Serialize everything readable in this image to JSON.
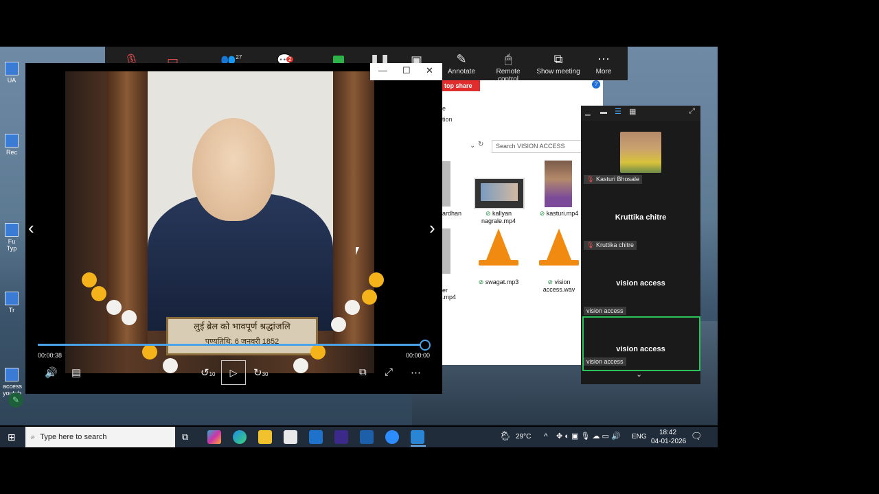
{
  "zoom_toolbar": {
    "participants_count": "27",
    "chat_badge": "2",
    "items": [
      {
        "label": "Annotate",
        "icon": "pencil-icon"
      },
      {
        "label": "Remote control",
        "icon": "mouse-icon"
      },
      {
        "label": "Show meeting",
        "icon": "meeting-windows-icon"
      },
      {
        "label": "More",
        "icon": "more-icon"
      }
    ],
    "stop_share": "top share"
  },
  "desktop_icons": [
    {
      "label": "UA"
    },
    {
      "label": "Rec"
    },
    {
      "label": "Fu Typ"
    },
    {
      "label": "Tr"
    },
    {
      "label": "access youtub"
    }
  ],
  "explorer": {
    "partial_text_1": "e",
    "partial_text_2": "tion",
    "search_placeholder": "Search VISION ACCESS",
    "files": [
      {
        "name": "ardhan",
        "checked": false
      },
      {
        "name": "kallyan nagrale.mp4",
        "checked": true
      },
      {
        "name": "kasturi.mp4",
        "checked": true
      },
      {
        "name": "er .mp4",
        "checked": false
      },
      {
        "name": "swagat.mp3",
        "checked": true
      },
      {
        "name": "vision access.wav",
        "checked": true
      }
    ]
  },
  "player": {
    "plaque_line1": "लुई ब्रेल को भावपूर्ण श्रद्धांजलि",
    "plaque_line2": "पुण्यतिथि: 6 जनवरी 1852",
    "time_elapsed": "00:00:38",
    "time_remaining": "00:00:00",
    "progress": 1.0,
    "skip_back": "10",
    "skip_forward": "30"
  },
  "gallery": {
    "participants": [
      {
        "name": "Kasturi Bhosale",
        "display": "",
        "muted": true
      },
      {
        "name": "Kruttika chitre",
        "display": "Kruttika chitre",
        "muted": true
      },
      {
        "name": "vision access",
        "display": "vision access",
        "muted": false
      },
      {
        "name": "vision access",
        "display": "vision access",
        "muted": false
      }
    ]
  },
  "taskbar": {
    "search_placeholder": "Type here to search",
    "weather": "29°C",
    "language": "ENG",
    "time": "18:42",
    "date": "04-01-2026"
  }
}
